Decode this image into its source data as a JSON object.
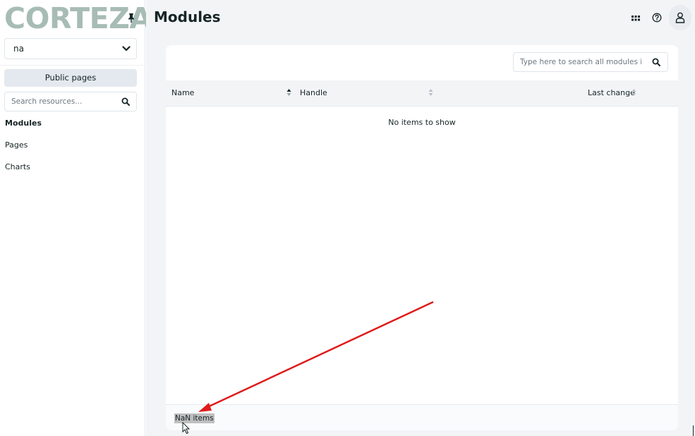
{
  "sidebar": {
    "logo": "CORTEZA",
    "namespace_value": "na",
    "public_pages_label": "Public pages",
    "search_placeholder": "Search resources...",
    "items": [
      {
        "label": "Modules",
        "active": true
      },
      {
        "label": "Pages",
        "active": false
      },
      {
        "label": "Charts",
        "active": false
      }
    ]
  },
  "header": {
    "title": "Modules"
  },
  "main": {
    "search_placeholder": "Type here to search all modules i...",
    "columns": [
      "Name",
      "Handle",
      "Last change"
    ],
    "empty_text": "No items to show",
    "count_text": "NaN items"
  },
  "colors": {
    "logo": "#a7bcb5",
    "accent_arrow": "#e01b1b",
    "background": "#f3f4f6"
  },
  "icons": [
    "pin-icon",
    "chevron-down-icon",
    "search-icon",
    "apps-grid-icon",
    "help-icon",
    "user-icon",
    "sort-icon",
    "mouse-cursor-icon"
  ]
}
